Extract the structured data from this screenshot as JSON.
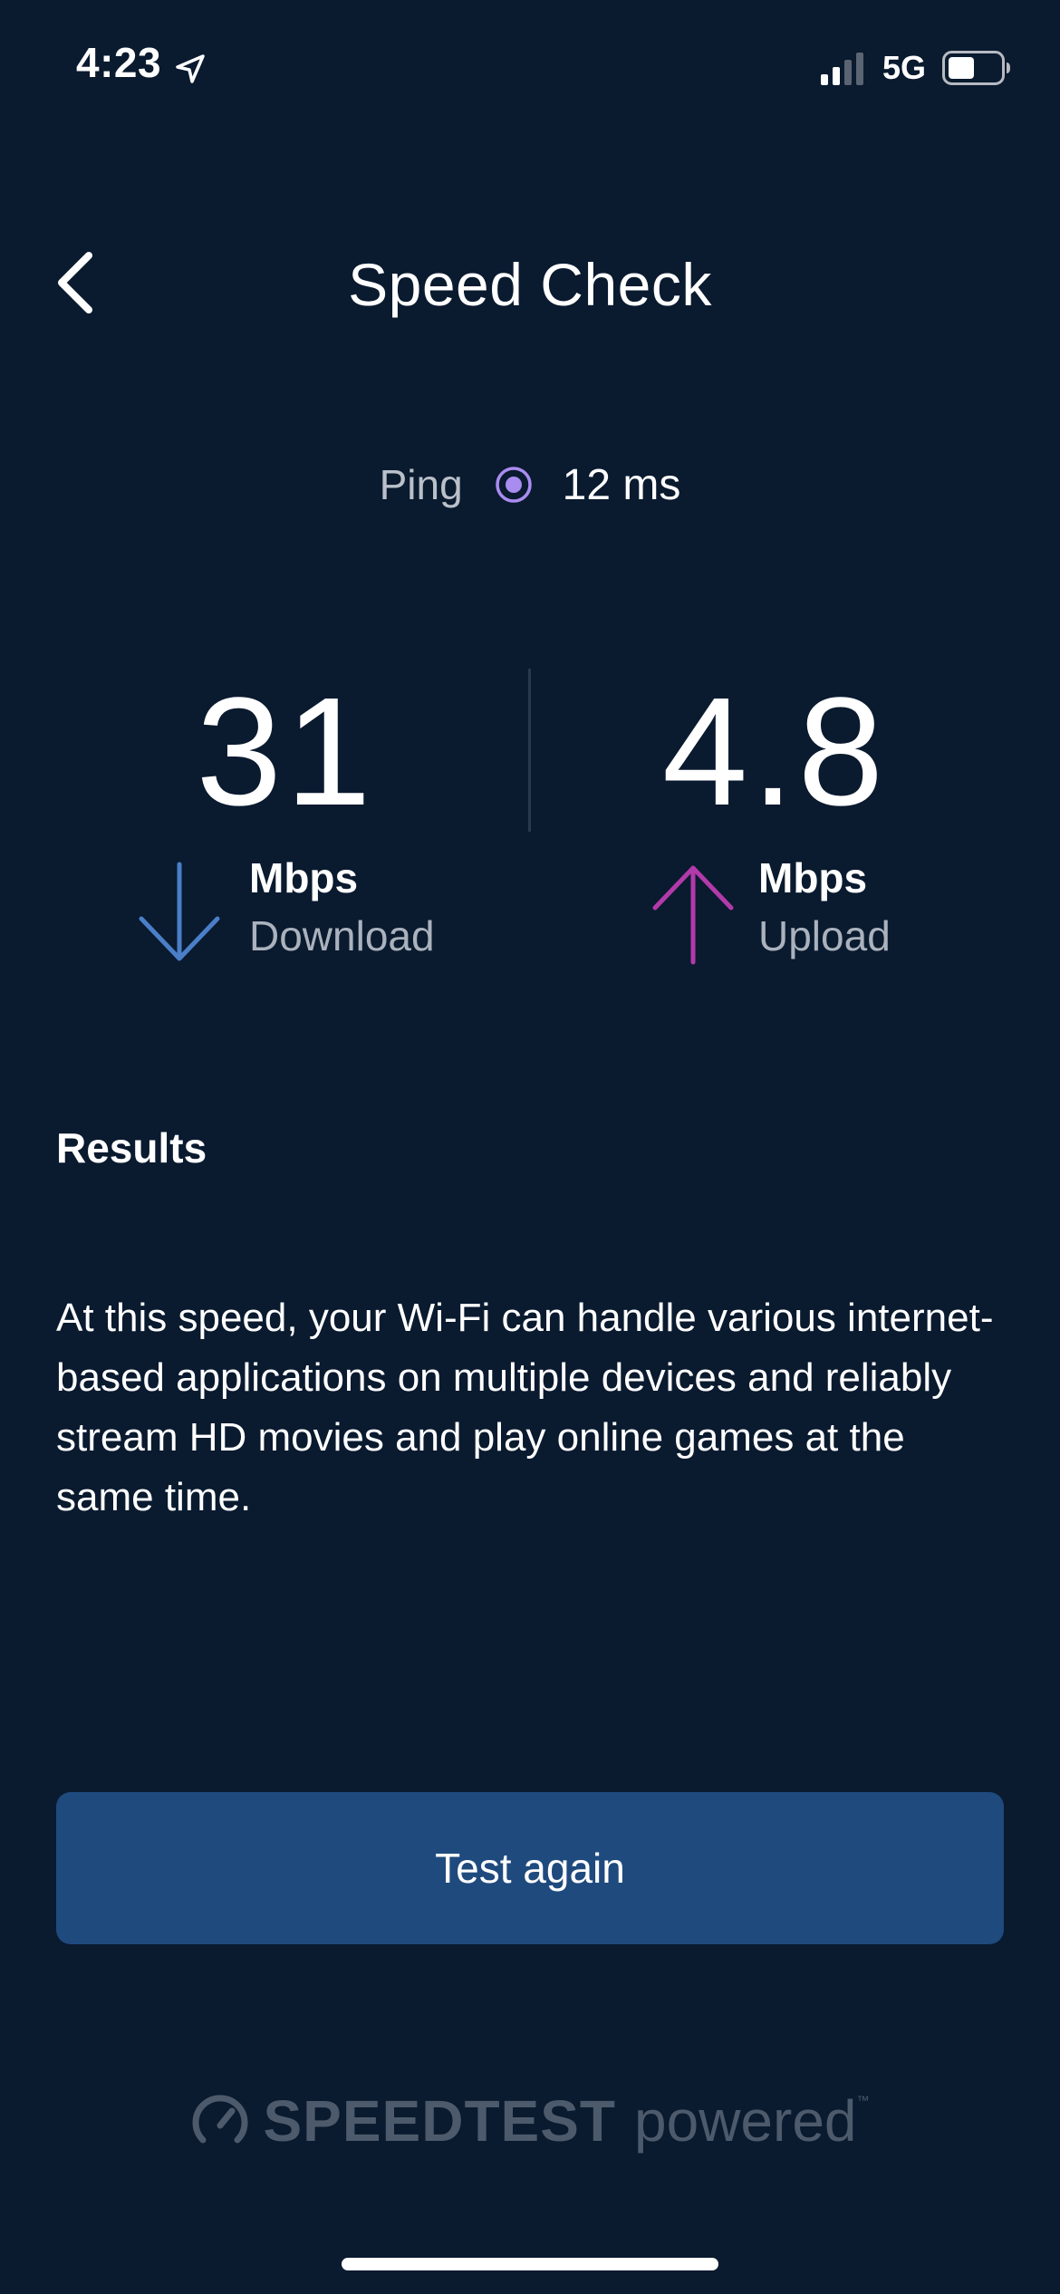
{
  "status_bar": {
    "time": "4:23",
    "network": "5G",
    "icons": [
      "location-arrow-icon",
      "signal-strength-icon",
      "battery-icon"
    ]
  },
  "header": {
    "title": "Speed Check",
    "back_icon": "chevron-left-icon"
  },
  "ping": {
    "label": "Ping",
    "value": "12 ms",
    "icon": "ping-dot-icon",
    "color": "#a98cf0"
  },
  "download": {
    "value": "31",
    "unit": "Mbps",
    "label": "Download",
    "icon": "arrow-down-icon",
    "color": "#4a7fc8"
  },
  "upload": {
    "value": "4.8",
    "unit": "Mbps",
    "label": "Upload",
    "icon": "arrow-up-icon",
    "color": "#b23aa9"
  },
  "results": {
    "heading": "Results",
    "description": "At this speed, your Wi-Fi can handle various internet-based applications on multiple devices and reliably stream HD movies and play online games at the same time."
  },
  "actions": {
    "test_again_label": "Test again"
  },
  "footer": {
    "brand": "SPEEDTEST",
    "suffix": "powered",
    "trademark": "™",
    "icon": "speedtest-gauge-icon"
  },
  "colors": {
    "background": "#0a1a2f",
    "button": "#1f4a7e",
    "muted_text": "#aab2bd"
  }
}
